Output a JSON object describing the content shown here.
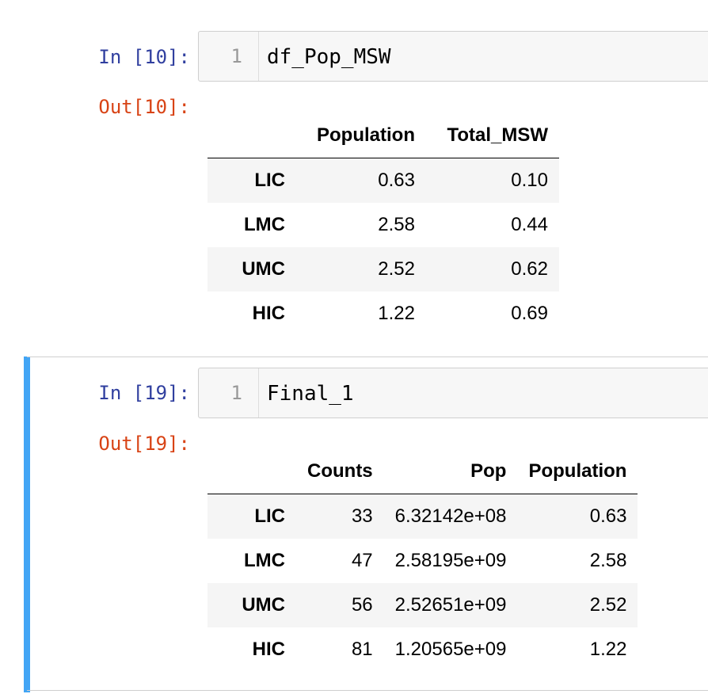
{
  "cell1": {
    "in_prompt": "In [10]:",
    "line_number": "1",
    "code": "df_Pop_MSW",
    "out_prompt": "Out[10]:",
    "table": {
      "columns": [
        "",
        "Population",
        "Total_MSW"
      ],
      "rows": [
        {
          "index": "LIC",
          "values": [
            "0.63",
            "0.10"
          ]
        },
        {
          "index": "LMC",
          "values": [
            "2.58",
            "0.44"
          ]
        },
        {
          "index": "UMC",
          "values": [
            "2.52",
            "0.62"
          ]
        },
        {
          "index": "HIC",
          "values": [
            "1.22",
            "0.69"
          ]
        }
      ]
    }
  },
  "cell2": {
    "in_prompt": "In [19]:",
    "line_number": "1",
    "code": "Final_1",
    "out_prompt": "Out[19]:",
    "table": {
      "columns": [
        "",
        "Counts",
        "Pop",
        "Population"
      ],
      "rows": [
        {
          "index": "LIC",
          "values": [
            "33",
            "6.32142e+08",
            "0.63"
          ]
        },
        {
          "index": "LMC",
          "values": [
            "47",
            "2.58195e+09",
            "2.58"
          ]
        },
        {
          "index": "UMC",
          "values": [
            "56",
            "2.52651e+09",
            "2.52"
          ]
        },
        {
          "index": "HIC",
          "values": [
            "81",
            "1.20565e+09",
            "1.22"
          ]
        }
      ]
    }
  },
  "colors": {
    "in_prompt": "#303f9f",
    "out_prompt": "#d84315",
    "selected_cell_bar": "#42a5f5",
    "input_background": "#f7f7f7"
  }
}
